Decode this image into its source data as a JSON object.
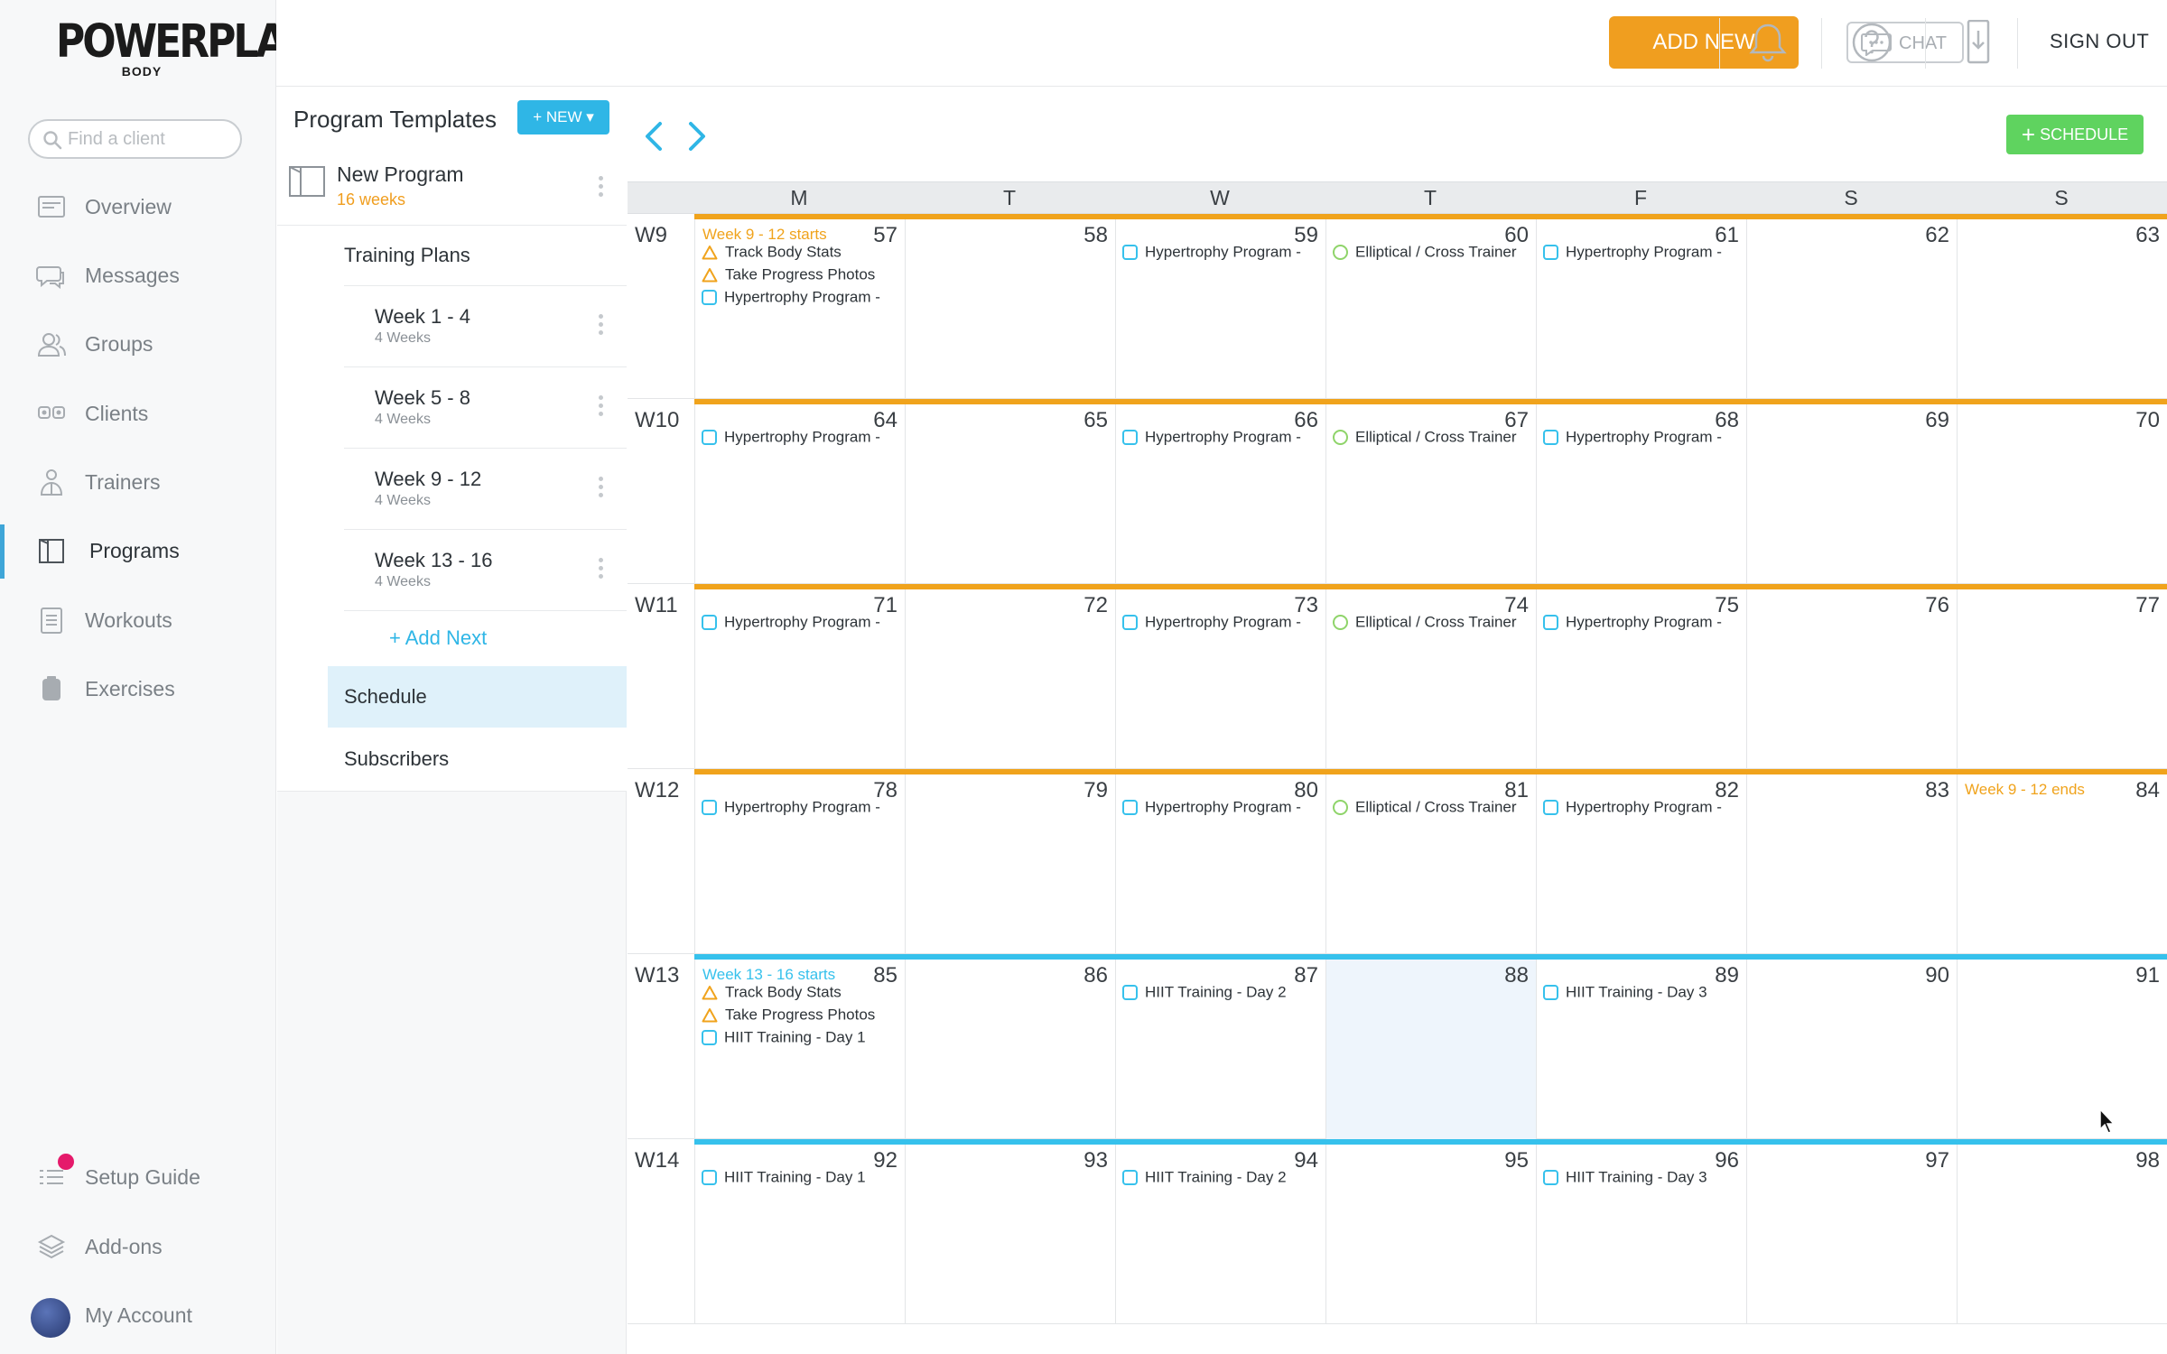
{
  "brand": {
    "logo_line1": "POWERPLANT",
    "logo_line2": "BODY"
  },
  "search": {
    "placeholder": "Find a client"
  },
  "nav": {
    "items": [
      {
        "label": "Overview",
        "icon": "overview-icon"
      },
      {
        "label": "Messages",
        "icon": "messages-icon"
      },
      {
        "label": "Groups",
        "icon": "groups-icon"
      },
      {
        "label": "Clients",
        "icon": "clients-icon"
      },
      {
        "label": "Trainers",
        "icon": "trainers-icon"
      },
      {
        "label": "Programs",
        "icon": "programs-icon",
        "active": true
      },
      {
        "label": "Workouts",
        "icon": "workouts-icon"
      },
      {
        "label": "Exercises",
        "icon": "exercises-icon"
      }
    ],
    "bottom": [
      {
        "label": "Setup Guide",
        "icon": "setup-guide-icon"
      },
      {
        "label": "Add-ons",
        "icon": "add-ons-icon"
      },
      {
        "label": "My Account",
        "icon": "avatar"
      }
    ]
  },
  "topbar": {
    "add_new": "ADD NEW",
    "chat": "CHAT",
    "sign_out": "SIGN OUT"
  },
  "panel": {
    "title": "Program Templates",
    "new_button": "+ NEW ▾",
    "program_name": "New Program",
    "program_weeks": "16 weeks",
    "training_plans": "Training Plans",
    "plans": [
      {
        "name": "Week 1 - 4",
        "weeks": "4 Weeks"
      },
      {
        "name": "Week 5 - 8",
        "weeks": "4 Weeks"
      },
      {
        "name": "Week 9 - 12",
        "weeks": "4 Weeks"
      },
      {
        "name": "Week 13 - 16",
        "weeks": "4 Weeks"
      }
    ],
    "add_next": "+ Add Next",
    "schedule": "Schedule",
    "subscribers": "Subscribers"
  },
  "calendar": {
    "schedule_button": "SCHEDULE",
    "day_headers": [
      "M",
      "T",
      "W",
      "T",
      "F",
      "S",
      "S"
    ],
    "colors": {
      "orange": "#f0a31c",
      "blue": "#36c1ec",
      "green": "#8fd46a",
      "today_highlight": "#eef5fc"
    },
    "weeks": [
      {
        "label": "W9",
        "bar_color": "#f0a31c",
        "days": [
          {
            "num": "57",
            "note": "Week 9 - 12 starts",
            "note_color": "#f0a31c",
            "events": [
              {
                "shape": "triangle",
                "color": "#f0a31c",
                "text": "Track Body Stats"
              },
              {
                "shape": "triangle",
                "color": "#f0a31c",
                "text": "Take Progress Photos"
              },
              {
                "shape": "square",
                "color": "#36c1ec",
                "text": "Hypertrophy Program -"
              }
            ]
          },
          {
            "num": "58",
            "events": []
          },
          {
            "num": "59",
            "events": [
              {
                "shape": "square",
                "color": "#36c1ec",
                "text": "Hypertrophy Program -"
              }
            ]
          },
          {
            "num": "60",
            "events": [
              {
                "shape": "circle",
                "color": "#8fd46a",
                "text": "Elliptical / Cross Trainer"
              }
            ]
          },
          {
            "num": "61",
            "events": [
              {
                "shape": "square",
                "color": "#36c1ec",
                "text": "Hypertrophy Program -"
              }
            ]
          },
          {
            "num": "62",
            "events": []
          },
          {
            "num": "63",
            "events": []
          }
        ]
      },
      {
        "label": "W10",
        "bar_color": "#f0a31c",
        "days": [
          {
            "num": "64",
            "events": [
              {
                "shape": "square",
                "color": "#36c1ec",
                "text": "Hypertrophy Program -"
              }
            ]
          },
          {
            "num": "65",
            "events": []
          },
          {
            "num": "66",
            "events": [
              {
                "shape": "square",
                "color": "#36c1ec",
                "text": "Hypertrophy Program -"
              }
            ]
          },
          {
            "num": "67",
            "events": [
              {
                "shape": "circle",
                "color": "#8fd46a",
                "text": "Elliptical / Cross Trainer"
              }
            ]
          },
          {
            "num": "68",
            "events": [
              {
                "shape": "square",
                "color": "#36c1ec",
                "text": "Hypertrophy Program -"
              }
            ]
          },
          {
            "num": "69",
            "events": []
          },
          {
            "num": "70",
            "events": []
          }
        ]
      },
      {
        "label": "W11",
        "bar_color": "#f0a31c",
        "days": [
          {
            "num": "71",
            "events": [
              {
                "shape": "square",
                "color": "#36c1ec",
                "text": "Hypertrophy Program -"
              }
            ]
          },
          {
            "num": "72",
            "events": []
          },
          {
            "num": "73",
            "events": [
              {
                "shape": "square",
                "color": "#36c1ec",
                "text": "Hypertrophy Program -"
              }
            ]
          },
          {
            "num": "74",
            "events": [
              {
                "shape": "circle",
                "color": "#8fd46a",
                "text": "Elliptical / Cross Trainer"
              }
            ]
          },
          {
            "num": "75",
            "events": [
              {
                "shape": "square",
                "color": "#36c1ec",
                "text": "Hypertrophy Program -"
              }
            ]
          },
          {
            "num": "76",
            "events": []
          },
          {
            "num": "77",
            "events": []
          }
        ]
      },
      {
        "label": "W12",
        "bar_color": "#f0a31c",
        "days": [
          {
            "num": "78",
            "events": [
              {
                "shape": "square",
                "color": "#36c1ec",
                "text": "Hypertrophy Program -"
              }
            ]
          },
          {
            "num": "79",
            "events": []
          },
          {
            "num": "80",
            "events": [
              {
                "shape": "square",
                "color": "#36c1ec",
                "text": "Hypertrophy Program -"
              }
            ]
          },
          {
            "num": "81",
            "events": [
              {
                "shape": "circle",
                "color": "#8fd46a",
                "text": "Elliptical / Cross Trainer"
              }
            ]
          },
          {
            "num": "82",
            "events": [
              {
                "shape": "square",
                "color": "#36c1ec",
                "text": "Hypertrophy Program -"
              }
            ]
          },
          {
            "num": "83",
            "events": []
          },
          {
            "num": "84",
            "note": "Week 9 - 12 ends",
            "note_color": "#f0a31c",
            "events": []
          }
        ]
      },
      {
        "label": "W13",
        "bar_color": "#36c1ec",
        "days": [
          {
            "num": "85",
            "note": "Week 13 - 16 starts",
            "note_color": "#36c1ec",
            "events": [
              {
                "shape": "triangle",
                "color": "#f0a31c",
                "text": "Track Body Stats"
              },
              {
                "shape": "triangle",
                "color": "#f0a31c",
                "text": "Take Progress Photos"
              },
              {
                "shape": "square",
                "color": "#36c1ec",
                "text": "HIIT Training - Day 1"
              }
            ]
          },
          {
            "num": "86",
            "events": []
          },
          {
            "num": "87",
            "events": [
              {
                "shape": "square",
                "color": "#36c1ec",
                "text": "HIIT Training - Day 2"
              }
            ]
          },
          {
            "num": "88",
            "highlight": true,
            "events": []
          },
          {
            "num": "89",
            "events": [
              {
                "shape": "square",
                "color": "#36c1ec",
                "text": "HIIT Training - Day 3"
              }
            ]
          },
          {
            "num": "90",
            "events": []
          },
          {
            "num": "91",
            "events": []
          }
        ]
      },
      {
        "label": "W14",
        "bar_color": "#36c1ec",
        "days": [
          {
            "num": "92",
            "events": [
              {
                "shape": "square",
                "color": "#36c1ec",
                "text": "HIIT Training - Day 1"
              }
            ]
          },
          {
            "num": "93",
            "events": []
          },
          {
            "num": "94",
            "events": [
              {
                "shape": "square",
                "color": "#36c1ec",
                "text": "HIIT Training - Day 2"
              }
            ]
          },
          {
            "num": "95",
            "events": []
          },
          {
            "num": "96",
            "events": [
              {
                "shape": "square",
                "color": "#36c1ec",
                "text": "HIIT Training - Day 3"
              }
            ]
          },
          {
            "num": "97",
            "events": []
          },
          {
            "num": "98",
            "events": []
          }
        ]
      }
    ]
  }
}
